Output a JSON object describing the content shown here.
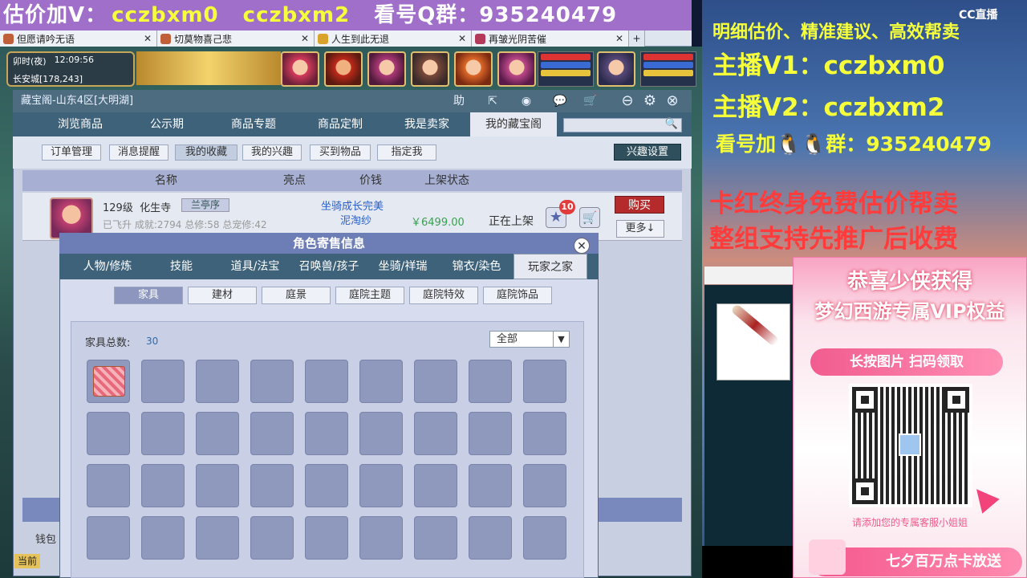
{
  "banner": {
    "left": "估价加V：",
    "v1": "cczbxm0",
    "v2": "cczbxm2",
    "right": "看号Q群：935240479"
  },
  "window_tabs": [
    {
      "label": "但愿请吟无语"
    },
    {
      "label": "切莫物喜己悲"
    },
    {
      "label": "人生到此无退"
    },
    {
      "label": "再皱光阴苦催"
    }
  ],
  "hud": {
    "time": "卯时(夜)",
    "clock": "12:09:56",
    "location": "长安城[178,243]"
  },
  "panel": {
    "title": "藏宝阁-山东4区[大明湖]",
    "toolbar_icons": [
      "help-icon",
      "share-icon",
      "record-icon",
      "chat-icon",
      "cart-icon",
      "minimize-icon",
      "settings-icon",
      "close-icon"
    ],
    "help_label": "助"
  },
  "nav_tabs": [
    "浏览商品",
    "公示期",
    "商品专题",
    "商品定制",
    "我是卖家",
    "我的藏宝阁"
  ],
  "sub_buttons": [
    "订单管理",
    "消息提醒",
    "我的收藏",
    "我的兴趣",
    "买到物品",
    "指定我"
  ],
  "hobby_setting": "兴趣设置",
  "table_headers": [
    "名称",
    "亮点",
    "价钱",
    "上架状态"
  ],
  "item": {
    "level": "129级",
    "school": "化生寺",
    "badge": "兰亭序",
    "stats": "已飞升 成就:2794 总修:58 总宠修:42",
    "highlight1": "坐骑成长完美",
    "highlight2": "泥淘纱",
    "price": "￥6499.00",
    "status": "正在上架",
    "star_count": "10",
    "buy": "购买",
    "more": "更多↓"
  },
  "wallet": "钱包",
  "current_label": "当前",
  "popup": {
    "title": "角色寄售信息",
    "tabs": [
      "人物/修炼",
      "技能",
      "道具/法宝",
      "召唤兽/孩子",
      "坐骑/祥瑞",
      "锦衣/染色",
      "玩家之家"
    ],
    "cat_tabs": [
      "家具",
      "建材",
      "庭景",
      "庭院主题",
      "庭院特效",
      "庭院饰品"
    ],
    "count_label": "家具总数:",
    "count_value": "30",
    "filter": "全部"
  },
  "sidebar": {
    "line1": "明细估价、精准建议、高效帮卖",
    "line2": "主播V1：cczbxm0",
    "line3": "主播V2：cczbxm2",
    "line4": "看号加🐧🐧群：935240479",
    "line5": "卡红终身免费估价帮卖",
    "line6": "整组支持先推广后收费",
    "cc_logo": "CC直播",
    "vip_title1": "恭喜少侠获得",
    "vip_title2": "梦幻西游专属VIP权益",
    "vip_pill": "长按图片 扫码领取",
    "vip_hint": "请添加您的专属客服小姐姐",
    "vip_bottom": "七夕百万点卡放送"
  }
}
